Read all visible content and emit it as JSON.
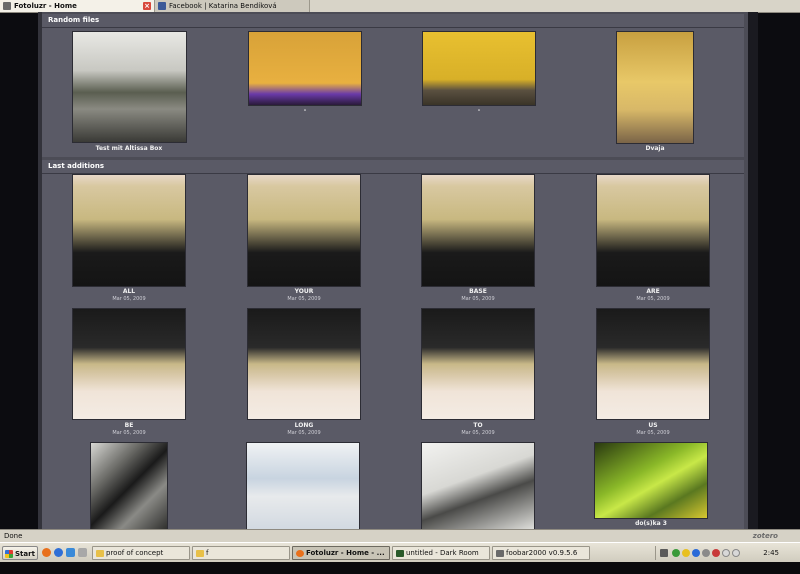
{
  "browser": {
    "tabs": [
      {
        "label": "Fotoluzr - Home",
        "active": true,
        "favicon": "fotoluzr-icon"
      },
      {
        "label": "Facebook | Katarina Bendíková",
        "active": false,
        "favicon": "facebook-icon"
      }
    ]
  },
  "page": {
    "random_files": {
      "title": "Random files",
      "items": [
        {
          "caption": "Test mit Altissa Box"
        },
        {
          "caption": "-"
        },
        {
          "caption": "-"
        },
        {
          "caption": "Dvaja"
        }
      ]
    },
    "last_additions": {
      "title": "Last additions",
      "items": [
        {
          "caption": "ALL",
          "date": "Mar 05, 2009"
        },
        {
          "caption": "YOUR",
          "date": "Mar 05, 2009"
        },
        {
          "caption": "BASE",
          "date": "Mar 05, 2009"
        },
        {
          "caption": "ARE",
          "date": "Mar 05, 2009"
        },
        {
          "caption": "BE",
          "date": "Mar 05, 2009"
        },
        {
          "caption": "LONG",
          "date": "Mar 05, 2009"
        },
        {
          "caption": "TO",
          "date": "Mar 05, 2009"
        },
        {
          "caption": "US",
          "date": "Mar 05, 2009"
        },
        {
          "caption": "",
          "date": ""
        },
        {
          "caption": "",
          "date": ""
        },
        {
          "caption": "",
          "date": ""
        },
        {
          "caption": "do(s)ka 3",
          "date": ""
        }
      ]
    }
  },
  "statusbar": {
    "text": "Done",
    "zotero": "zotero"
  },
  "taskbar": {
    "start": "Start",
    "tasks": [
      {
        "label": "proof of concept",
        "icon": "folder-icon"
      },
      {
        "label": "f",
        "icon": "folder-icon"
      },
      {
        "label": "Fotoluzr - Home - ...",
        "icon": "firefox-icon",
        "active": true
      },
      {
        "label": "untitled - Dark Room",
        "icon": "darkroom-icon"
      },
      {
        "label": "foobar2000 v0.9.5.6",
        "icon": "foobar-icon"
      }
    ],
    "clock": "2:45"
  },
  "colors": {
    "page_bg": "#4c4c56",
    "section_bg": "#5a5a66",
    "caption": "#f2f2f2"
  }
}
